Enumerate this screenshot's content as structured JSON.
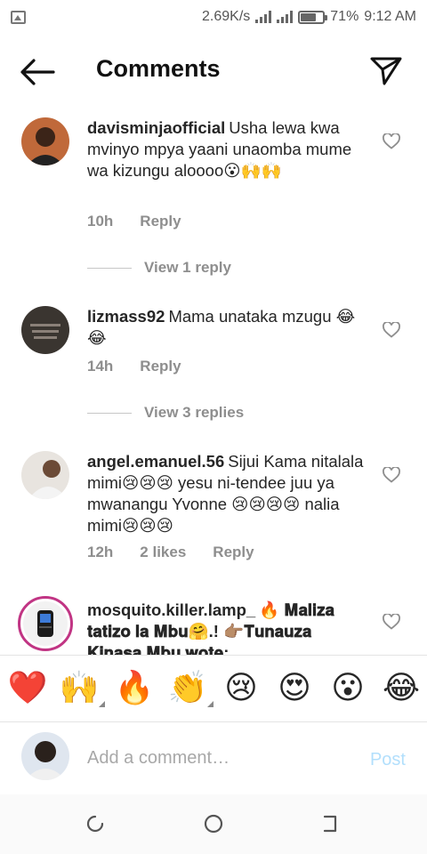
{
  "status_bar": {
    "speed": "2.69K/s",
    "battery_percent": "71%",
    "time": "9:12 AM",
    "battery_level": 0.71
  },
  "header": {
    "title": "Comments",
    "back_icon": "arrow-left-icon",
    "share_icon": "paper-plane-icon"
  },
  "comments": [
    {
      "username": "davisminjaofficial",
      "text": "Usha lewa kwa mvinyo mpya yaani unaomba mume wa kizungu aloooo😮🙌🙌",
      "time": "10h",
      "likes": "",
      "reply_label": "Reply",
      "view_replies": "View 1 reply"
    },
    {
      "username": "lizmass92",
      "text": "Mama unataka mzugu 😂😂",
      "time": "14h",
      "likes": "",
      "reply_label": "Reply",
      "view_replies": "View 3 replies"
    },
    {
      "username": "angel.emanuel.56",
      "text": "Sijui Kama nitalala mimi😢😢😢 yesu ni-tendee juu ya mwanangu Yvonne 😢😢😢😢 nalia mimi😢😢😢",
      "time": "12h",
      "likes": "2 likes",
      "reply_label": "Reply",
      "view_replies": ""
    },
    {
      "username": "mosquito.killer.lamp_",
      "text": "🔥 𝐌𝐚𝐥𝐢𝐳𝐚 𝐭𝐚𝐭𝐢𝐳𝐨 𝐥𝐚 𝐌𝐛𝐮🤗.! 👉🏽𝐓𝐮𝐧𝐚𝐮𝐳𝐚 𝐊𝐢𝐧𝐚𝐬𝐚 𝐌𝐛𝐮 𝐰𝐨𝐭𝐞:",
      "time": "",
      "likes": "",
      "reply_label": "",
      "view_replies": ""
    }
  ],
  "reactions": [
    "❤️",
    "🙌",
    "🔥",
    "👏",
    "😢",
    "😍",
    "😮",
    "😂"
  ],
  "add_comment": {
    "placeholder": "Add a comment…",
    "post_label": "Post"
  },
  "colors": {
    "text": "#262626",
    "secondary": "#8e8e8e",
    "post_disabled": "#b2dffc",
    "story_ring": "#c13584"
  }
}
